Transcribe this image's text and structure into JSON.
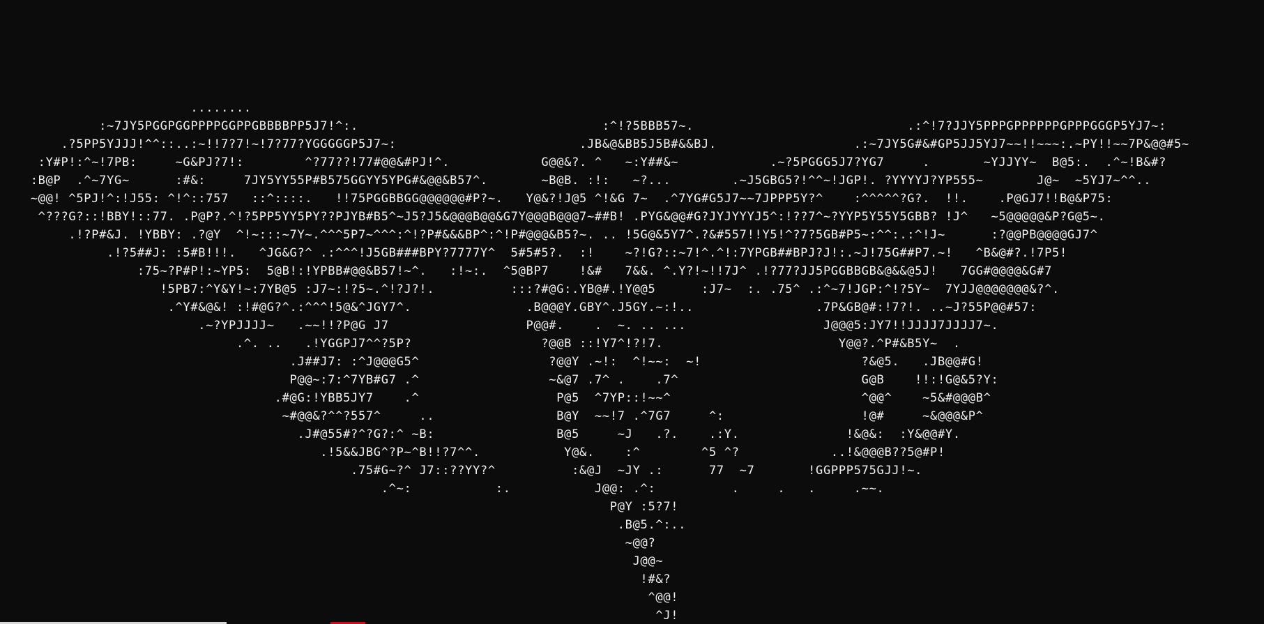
{
  "terminal": {
    "background": "#0c0c0c",
    "foreground": "#f2f2f2",
    "accent": "#c50f1f",
    "ascii_lines": [
      "                         ........",
      "             :~7JY5PGGPGGPPPPGGPPGBBBBPP5J7!^:.                                :^!?5BBB57~.                            .:^!7?JJY5PPPGPPPPPPGPPPGGGP5YJ7~:",
      "        .?5PP5YJJJ!^^::..:~!!7?7!~!7?77?YGGGGGP5J7~:                        .JB&@&BB5J5B#&&BJ.                  .:~7JY5G#&#GP5JJ5YJ7~~!!~~~:.~PY!!~~7P&@@#5~",
      "     :Y#P!:^~!7PB:     ~G&PJ?7!:        ^?77??!77#@@&#PJ!^.            G@@&?. ^   ~:Y##&~            .~?5PGGG5J7?YG7     .       ~YJJYY~  B@5:.  .^~!B&#?",
      "    :B@P  .^~7YG~      :#&:     7JY5YY55P#B575GGYY5YPG#&@@&B57^.       ~B@B. :!:   ~?...        .~J5GBG5?!^^~!JGP!. ?YYYYJ?YP555~       J@~  ~5YJ7~^^..",
      "    ~@@! ^5PJ!^:!J55: ^!^::757   ::^::::.   !!75PGGBBGG@@@@@@#P?~.   Y@&?!J@5 ^!&G 7~  .^7YG#G5J7~~7JPPP5Y?^    :^^^^^?G?.  !!.    .P@GJ7!!B@&P75:",
      "     ^???G?::!BBY!::77. .P@P?.^!?5PP5YY5PY??PJYB#B5^~J5?J5&@@@B@@&G7Y@@@B@@@7~##B! .PYG&@@#G?JYJYYYJ5^:!??7^~?YYP5Y55Y5GBB? !J^   ~5@@@@@&P?G@5~.",
      "         .!?P#&J. !YBBY: .?@Y  ^!~:::~7Y~.^^^5P7~^^^:^!?P#&&&BP^:^!P#@@@&B5?~. .. !5G@&5Y7^.?&#557!!Y5!^?7?5GB#P5~:^^:.:^!J~      :?@@PB@@@@GJ7^",
      "              .!?5##J: :5#B!!!.   ^JG&G?^ .:^^^!J5GB###BPY?7777Y^  5#5#5?.  :!    ~?!G?::~7!^.^!:7YPGB##BPJ?J!:.~J!75G##P7.~!   ^B&@#?.!7P5!",
      "                  :75~?P#P!:~YP5:  5@B!:!YPBB#@@&B57!~^.   :!~:.  ^5@BP7    !&#   7&&. ^.Y?!~!!7J^ .!?77?JJ5PGGBBGB&@&&@5J!   7GG#@@@@&G#7",
      "                     !5PB7:^Y&Y!~:7YB@5 :J7~:!?5~.^!?J?!.          :::?#@G:.YB@#.!Y@@5      :J7~  :. .75^ .:^~7!JGP:^!?5Y~  7YJJ@@@@@@@&?^.",
      "                      .^Y#&@&! :!#@G?^.:^^^!5@&^JGY7^.               .B@@@Y.GBY^.J5GY.~:!..                .7P&GB@#:!7?!. ..~J?55P@@#57:",
      "                          .~?YPJJJJ~   .~~!!?P@G J7                  P@@#.    .  ~. .. ...                  J@@@5:JY7!!JJJJ7JJJJ7~.",
      "                               .^. ..   .!YGGPJ7^^?5P?                 ?@@B ::!Y7^!?!7.                       Y@@?.^P#&B5Y~  .",
      "                                      .J##J7: :^J@@@G5^                 ?@@Y .~!:  ^!~~:  ~!                     ?&@5.   .JB@@#G!",
      "                                      P@@~:7:^7YB#G7 .^                 ~&@7 .7^ .    .7^                        G@B    !!:!G@&5?Y:",
      "                                    .#@G:!YBB5JY7    .^                  P@5  ^7YP::!~~^                         ^@@^    ~5&#@@@B^",
      "                                     ~#@@&?^^?557^     ..                B@Y  ~~!7 .^7G7     ^:                  !@#     ~&@@@&P^",
      "                                       .J#@55#?^?G?:^ ~B:                B@5     ~J   .?.    .:Y.              !&@&:  :Y&@@#Y.",
      "                                          .!5&&JBG^?P~^B!!?7^^.           Y@&.    :^        ^5 ^?            ..!&@@@B??5@#P!",
      "                                              .75#G~?^ J7::??YY?^          :&@J  ~JY .:      77  ~7       !GGPPP575GJJ!~.",
      "                                                  .^~:           :.           J@@: .^:          .     .   .     .~~.",
      "                                                                                P@Y :5?7!",
      "                                                                                 .B@5.^:..",
      "                                                                                  ~@@?",
      "                                                                                   J@@~",
      "                                                                                    !#&?",
      "                                                                                     ^@@!",
      "                                                                                      ^J!"
    ]
  }
}
